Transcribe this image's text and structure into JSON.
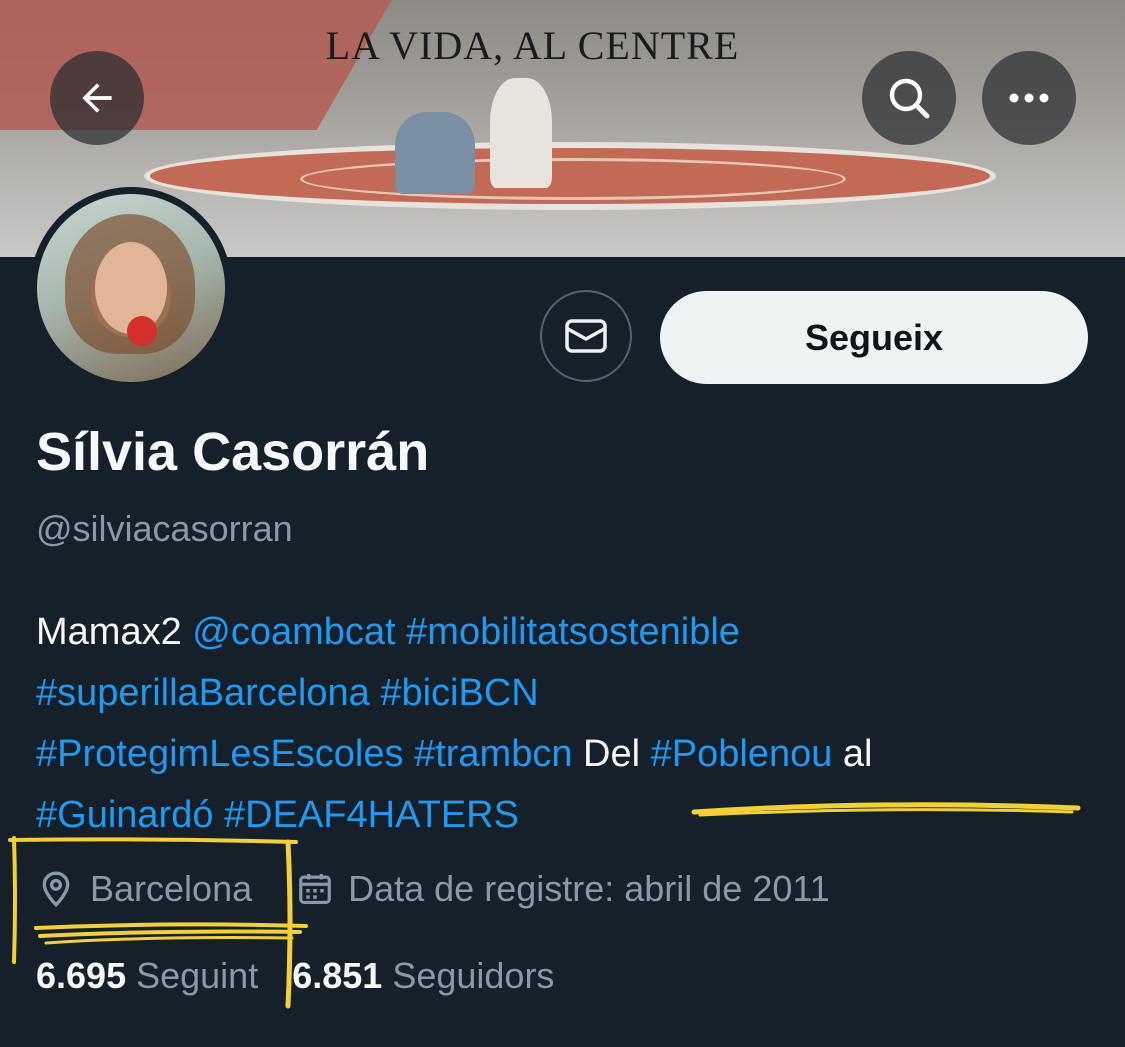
{
  "banner": {
    "title": "LA VIDA, AL CENTRE"
  },
  "icons": {
    "back": "arrow-left-icon",
    "search": "search-icon",
    "more": "more-horizontal-icon",
    "message": "mail-icon",
    "location": "map-pin-icon",
    "calendar": "calendar-icon"
  },
  "actions": {
    "follow_label": "Segueix"
  },
  "profile": {
    "name": "Sílvia Casorrán",
    "handle": "@silviacasorran",
    "bio": {
      "t1": "Mamax2 ",
      "l1": "@coambcat",
      "l2": "#mobilitatsostenible",
      "l3": "#superillaBarcelona",
      "l4": "#biciBCN",
      "l5": "#ProtegimLesEscoles",
      "l6": "#trambcn",
      "t2": " Del ",
      "l7": "#Poblenou",
      "t3": " al",
      "l8": "#Guinardó",
      "l9": "#DEAF4HATERS"
    },
    "location": "Barcelona",
    "joined": "Data de registre: abril de 2011",
    "following_count": "6.695",
    "following_label": "Seguint",
    "followers_count": "6.851",
    "followers_label": "Seguidors"
  },
  "colors": {
    "background": "#15202b",
    "link": "#1d9bf0",
    "muted": "#8b98a5",
    "highlight": "#f2d230"
  }
}
